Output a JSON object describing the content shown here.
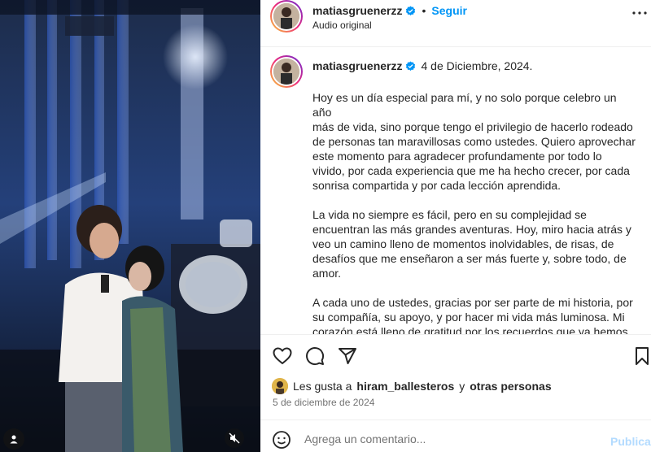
{
  "post": {
    "username": "matiasgruenerzz",
    "follow_label": "Seguir",
    "audio_label": "Audio original",
    "caption_date": "4 de Diciembre, 2024.",
    "caption_paragraphs": [
      "Hoy es un día especial para mí, y no solo porque celebro un año\nmás de vida, sino porque tengo el privilegio de hacerlo rodeado\nde personas tan maravillosas como ustedes. Quiero aprovechar\neste momento para agradecer profundamente por todo lo\nvivido, por cada experiencia que me ha hecho crecer, por cada\nsonrisa compartida y por cada lección aprendida.",
      "La vida no siempre es fácil, pero en su complejidad se\nencuentran las más grandes aventuras. Hoy, miro hacia atrás y\nveo un camino lleno de momentos inolvidables, de risas, de\ndesafíos que me enseñaron a ser más fuerte y, sobre todo, de\namor.",
      "A cada uno de ustedes, gracias por ser parte de mi historia, por\nsu compañía, su apoyo, y por hacer mi vida más luminosa. Mi\ncorazón está lleno de gratitud por los recuerdos que ya hemos\ncreado juntos y por los que aún están por venir."
    ],
    "likes": {
      "prefix": "Les gusta a",
      "user": "hiram_ballesteros",
      "connector": "y",
      "others": "otras personas"
    },
    "post_date": "5 de diciembre de 2024",
    "comment_placeholder": "Agrega un comentario...",
    "publish_label": "Publicar"
  },
  "icons": {
    "verified": "verified-badge-icon",
    "more": "more-options-icon",
    "like": "heart-icon",
    "comment": "comment-icon",
    "share": "paper-plane-icon",
    "save": "bookmark-icon",
    "emoji": "emoji-icon",
    "mute": "muted-speaker-icon",
    "user_tag": "user-tag-icon"
  },
  "colors": {
    "accent": "#0095f6",
    "verified": "#0095f6",
    "text": "#262626",
    "muted": "#737373"
  }
}
